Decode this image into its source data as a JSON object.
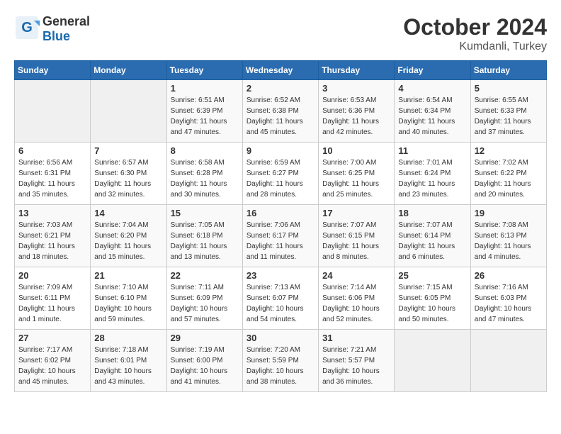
{
  "header": {
    "logo_general": "General",
    "logo_blue": "Blue",
    "month": "October 2024",
    "location": "Kumdanli, Turkey"
  },
  "weekdays": [
    "Sunday",
    "Monday",
    "Tuesday",
    "Wednesday",
    "Thursday",
    "Friday",
    "Saturday"
  ],
  "weeks": [
    [
      {
        "day": "",
        "info": ""
      },
      {
        "day": "",
        "info": ""
      },
      {
        "day": "1",
        "info": "Sunrise: 6:51 AM\nSunset: 6:39 PM\nDaylight: 11 hours and 47 minutes."
      },
      {
        "day": "2",
        "info": "Sunrise: 6:52 AM\nSunset: 6:38 PM\nDaylight: 11 hours and 45 minutes."
      },
      {
        "day": "3",
        "info": "Sunrise: 6:53 AM\nSunset: 6:36 PM\nDaylight: 11 hours and 42 minutes."
      },
      {
        "day": "4",
        "info": "Sunrise: 6:54 AM\nSunset: 6:34 PM\nDaylight: 11 hours and 40 minutes."
      },
      {
        "day": "5",
        "info": "Sunrise: 6:55 AM\nSunset: 6:33 PM\nDaylight: 11 hours and 37 minutes."
      }
    ],
    [
      {
        "day": "6",
        "info": "Sunrise: 6:56 AM\nSunset: 6:31 PM\nDaylight: 11 hours and 35 minutes."
      },
      {
        "day": "7",
        "info": "Sunrise: 6:57 AM\nSunset: 6:30 PM\nDaylight: 11 hours and 32 minutes."
      },
      {
        "day": "8",
        "info": "Sunrise: 6:58 AM\nSunset: 6:28 PM\nDaylight: 11 hours and 30 minutes."
      },
      {
        "day": "9",
        "info": "Sunrise: 6:59 AM\nSunset: 6:27 PM\nDaylight: 11 hours and 28 minutes."
      },
      {
        "day": "10",
        "info": "Sunrise: 7:00 AM\nSunset: 6:25 PM\nDaylight: 11 hours and 25 minutes."
      },
      {
        "day": "11",
        "info": "Sunrise: 7:01 AM\nSunset: 6:24 PM\nDaylight: 11 hours and 23 minutes."
      },
      {
        "day": "12",
        "info": "Sunrise: 7:02 AM\nSunset: 6:22 PM\nDaylight: 11 hours and 20 minutes."
      }
    ],
    [
      {
        "day": "13",
        "info": "Sunrise: 7:03 AM\nSunset: 6:21 PM\nDaylight: 11 hours and 18 minutes."
      },
      {
        "day": "14",
        "info": "Sunrise: 7:04 AM\nSunset: 6:20 PM\nDaylight: 11 hours and 15 minutes."
      },
      {
        "day": "15",
        "info": "Sunrise: 7:05 AM\nSunset: 6:18 PM\nDaylight: 11 hours and 13 minutes."
      },
      {
        "day": "16",
        "info": "Sunrise: 7:06 AM\nSunset: 6:17 PM\nDaylight: 11 hours and 11 minutes."
      },
      {
        "day": "17",
        "info": "Sunrise: 7:07 AM\nSunset: 6:15 PM\nDaylight: 11 hours and 8 minutes."
      },
      {
        "day": "18",
        "info": "Sunrise: 7:07 AM\nSunset: 6:14 PM\nDaylight: 11 hours and 6 minutes."
      },
      {
        "day": "19",
        "info": "Sunrise: 7:08 AM\nSunset: 6:13 PM\nDaylight: 11 hours and 4 minutes."
      }
    ],
    [
      {
        "day": "20",
        "info": "Sunrise: 7:09 AM\nSunset: 6:11 PM\nDaylight: 11 hours and 1 minute."
      },
      {
        "day": "21",
        "info": "Sunrise: 7:10 AM\nSunset: 6:10 PM\nDaylight: 10 hours and 59 minutes."
      },
      {
        "day": "22",
        "info": "Sunrise: 7:11 AM\nSunset: 6:09 PM\nDaylight: 10 hours and 57 minutes."
      },
      {
        "day": "23",
        "info": "Sunrise: 7:13 AM\nSunset: 6:07 PM\nDaylight: 10 hours and 54 minutes."
      },
      {
        "day": "24",
        "info": "Sunrise: 7:14 AM\nSunset: 6:06 PM\nDaylight: 10 hours and 52 minutes."
      },
      {
        "day": "25",
        "info": "Sunrise: 7:15 AM\nSunset: 6:05 PM\nDaylight: 10 hours and 50 minutes."
      },
      {
        "day": "26",
        "info": "Sunrise: 7:16 AM\nSunset: 6:03 PM\nDaylight: 10 hours and 47 minutes."
      }
    ],
    [
      {
        "day": "27",
        "info": "Sunrise: 7:17 AM\nSunset: 6:02 PM\nDaylight: 10 hours and 45 minutes."
      },
      {
        "day": "28",
        "info": "Sunrise: 7:18 AM\nSunset: 6:01 PM\nDaylight: 10 hours and 43 minutes."
      },
      {
        "day": "29",
        "info": "Sunrise: 7:19 AM\nSunset: 6:00 PM\nDaylight: 10 hours and 41 minutes."
      },
      {
        "day": "30",
        "info": "Sunrise: 7:20 AM\nSunset: 5:59 PM\nDaylight: 10 hours and 38 minutes."
      },
      {
        "day": "31",
        "info": "Sunrise: 7:21 AM\nSunset: 5:57 PM\nDaylight: 10 hours and 36 minutes."
      },
      {
        "day": "",
        "info": ""
      },
      {
        "day": "",
        "info": ""
      }
    ]
  ]
}
